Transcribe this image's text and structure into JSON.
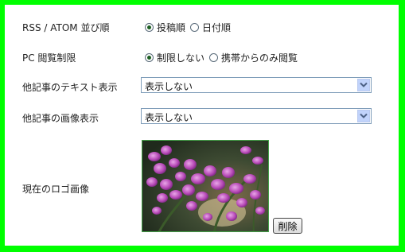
{
  "rss": {
    "label": "RSS / ATOM 並び順",
    "options": [
      "投稿順",
      "日付順"
    ],
    "selected": "投稿順"
  },
  "pc": {
    "label": "PC 閲覧制限",
    "options": [
      "制限しない",
      "携帯からのみ閲覧"
    ],
    "selected": "制限しない"
  },
  "text_display": {
    "label": "他記事のテキスト表示",
    "value": "表示しない"
  },
  "image_display": {
    "label": "他記事の画像表示",
    "value": "表示しない"
  },
  "logo": {
    "label": "現在のロゴ画像",
    "delete_label": "削除"
  },
  "colors": {
    "frame": "#00ff00",
    "select_border": "#7f9db9",
    "dropdown_button": "#c1d3fb"
  }
}
